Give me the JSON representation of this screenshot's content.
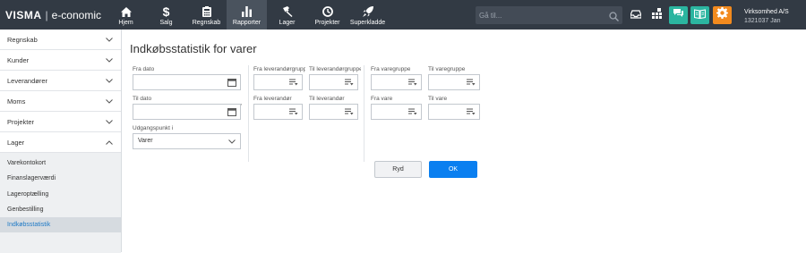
{
  "brand": {
    "mark": "VISMA",
    "separator": "|",
    "product": "e-conomic"
  },
  "nav": [
    {
      "label": "Hjem",
      "icon": "home-icon"
    },
    {
      "label": "Salg",
      "icon": "dollar-icon"
    },
    {
      "label": "Regnskab",
      "icon": "calculator-icon"
    },
    {
      "label": "Rapporter",
      "icon": "bar-chart-icon",
      "active": true
    },
    {
      "label": "Lager",
      "icon": "hammer-icon"
    },
    {
      "label": "Projekter",
      "icon": "clock-icon"
    },
    {
      "label": "Superkladde",
      "icon": "rocket-icon"
    }
  ],
  "search": {
    "placeholder": "Gå til..."
  },
  "toolbar_colors": {
    "chat": "#2bb5a0",
    "book": "#2bb5a0",
    "settings": "#f28a1e"
  },
  "company": {
    "name": "Virksomhed A/S",
    "number": "1321037 Jan"
  },
  "sidebar": {
    "items": [
      "Regnskab",
      "Kunder",
      "Leverandører",
      "Moms",
      "Projekter",
      "Lager"
    ],
    "subitems": [
      "Varekontokort",
      "Finanslagerværdi",
      "Lageroptælling",
      "Genbestilling",
      "Indkøbsstatistik"
    ],
    "active_subitem": "Indkøbsstatistik"
  },
  "page": {
    "title": "Indkøbsstatistik for varer",
    "fra_dato": "Fra dato",
    "til_dato": "Til dato",
    "udgangspunkt_label": "Udgangspunkt i",
    "udgangspunkt_value": "Varer",
    "fra_leverandorgruppe": "Fra leverandørgruppe",
    "til_leverandorgruppe": "Til leverandørgruppe",
    "fra_leverandor": "Fra leverandør",
    "til_leverandor": "Til leverandør",
    "fra_varegruppe": "Fra varegruppe",
    "til_varegruppe": "Til varegruppe",
    "fra_vare": "Fra vare",
    "til_vare": "Til vare",
    "ryd": "Ryd",
    "ok": "OK"
  }
}
